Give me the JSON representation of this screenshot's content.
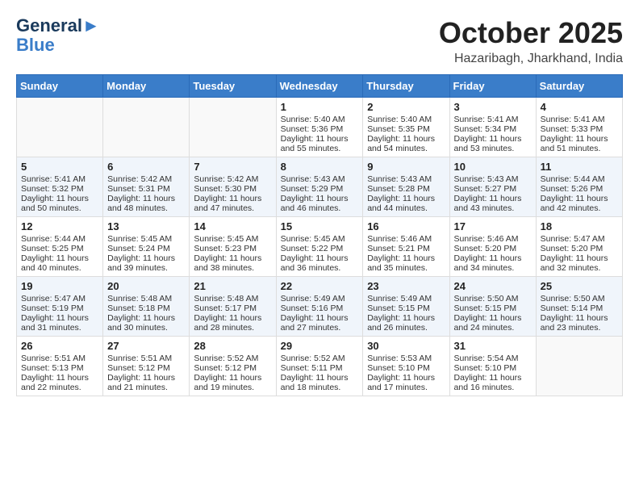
{
  "header": {
    "logo_line1": "General",
    "logo_line2": "Blue",
    "month": "October 2025",
    "location": "Hazaribagh, Jharkhand, India"
  },
  "weekdays": [
    "Sunday",
    "Monday",
    "Tuesday",
    "Wednesday",
    "Thursday",
    "Friday",
    "Saturday"
  ],
  "weeks": [
    [
      {
        "day": "",
        "info": ""
      },
      {
        "day": "",
        "info": ""
      },
      {
        "day": "",
        "info": ""
      },
      {
        "day": "1",
        "info": "Sunrise: 5:40 AM\nSunset: 5:36 PM\nDaylight: 11 hours\nand 55 minutes."
      },
      {
        "day": "2",
        "info": "Sunrise: 5:40 AM\nSunset: 5:35 PM\nDaylight: 11 hours\nand 54 minutes."
      },
      {
        "day": "3",
        "info": "Sunrise: 5:41 AM\nSunset: 5:34 PM\nDaylight: 11 hours\nand 53 minutes."
      },
      {
        "day": "4",
        "info": "Sunrise: 5:41 AM\nSunset: 5:33 PM\nDaylight: 11 hours\nand 51 minutes."
      }
    ],
    [
      {
        "day": "5",
        "info": "Sunrise: 5:41 AM\nSunset: 5:32 PM\nDaylight: 11 hours\nand 50 minutes."
      },
      {
        "day": "6",
        "info": "Sunrise: 5:42 AM\nSunset: 5:31 PM\nDaylight: 11 hours\nand 48 minutes."
      },
      {
        "day": "7",
        "info": "Sunrise: 5:42 AM\nSunset: 5:30 PM\nDaylight: 11 hours\nand 47 minutes."
      },
      {
        "day": "8",
        "info": "Sunrise: 5:43 AM\nSunset: 5:29 PM\nDaylight: 11 hours\nand 46 minutes."
      },
      {
        "day": "9",
        "info": "Sunrise: 5:43 AM\nSunset: 5:28 PM\nDaylight: 11 hours\nand 44 minutes."
      },
      {
        "day": "10",
        "info": "Sunrise: 5:43 AM\nSunset: 5:27 PM\nDaylight: 11 hours\nand 43 minutes."
      },
      {
        "day": "11",
        "info": "Sunrise: 5:44 AM\nSunset: 5:26 PM\nDaylight: 11 hours\nand 42 minutes."
      }
    ],
    [
      {
        "day": "12",
        "info": "Sunrise: 5:44 AM\nSunset: 5:25 PM\nDaylight: 11 hours\nand 40 minutes."
      },
      {
        "day": "13",
        "info": "Sunrise: 5:45 AM\nSunset: 5:24 PM\nDaylight: 11 hours\nand 39 minutes."
      },
      {
        "day": "14",
        "info": "Sunrise: 5:45 AM\nSunset: 5:23 PM\nDaylight: 11 hours\nand 38 minutes."
      },
      {
        "day": "15",
        "info": "Sunrise: 5:45 AM\nSunset: 5:22 PM\nDaylight: 11 hours\nand 36 minutes."
      },
      {
        "day": "16",
        "info": "Sunrise: 5:46 AM\nSunset: 5:21 PM\nDaylight: 11 hours\nand 35 minutes."
      },
      {
        "day": "17",
        "info": "Sunrise: 5:46 AM\nSunset: 5:20 PM\nDaylight: 11 hours\nand 34 minutes."
      },
      {
        "day": "18",
        "info": "Sunrise: 5:47 AM\nSunset: 5:20 PM\nDaylight: 11 hours\nand 32 minutes."
      }
    ],
    [
      {
        "day": "19",
        "info": "Sunrise: 5:47 AM\nSunset: 5:19 PM\nDaylight: 11 hours\nand 31 minutes."
      },
      {
        "day": "20",
        "info": "Sunrise: 5:48 AM\nSunset: 5:18 PM\nDaylight: 11 hours\nand 30 minutes."
      },
      {
        "day": "21",
        "info": "Sunrise: 5:48 AM\nSunset: 5:17 PM\nDaylight: 11 hours\nand 28 minutes."
      },
      {
        "day": "22",
        "info": "Sunrise: 5:49 AM\nSunset: 5:16 PM\nDaylight: 11 hours\nand 27 minutes."
      },
      {
        "day": "23",
        "info": "Sunrise: 5:49 AM\nSunset: 5:15 PM\nDaylight: 11 hours\nand 26 minutes."
      },
      {
        "day": "24",
        "info": "Sunrise: 5:50 AM\nSunset: 5:15 PM\nDaylight: 11 hours\nand 24 minutes."
      },
      {
        "day": "25",
        "info": "Sunrise: 5:50 AM\nSunset: 5:14 PM\nDaylight: 11 hours\nand 23 minutes."
      }
    ],
    [
      {
        "day": "26",
        "info": "Sunrise: 5:51 AM\nSunset: 5:13 PM\nDaylight: 11 hours\nand 22 minutes."
      },
      {
        "day": "27",
        "info": "Sunrise: 5:51 AM\nSunset: 5:12 PM\nDaylight: 11 hours\nand 21 minutes."
      },
      {
        "day": "28",
        "info": "Sunrise: 5:52 AM\nSunset: 5:12 PM\nDaylight: 11 hours\nand 19 minutes."
      },
      {
        "day": "29",
        "info": "Sunrise: 5:52 AM\nSunset: 5:11 PM\nDaylight: 11 hours\nand 18 minutes."
      },
      {
        "day": "30",
        "info": "Sunrise: 5:53 AM\nSunset: 5:10 PM\nDaylight: 11 hours\nand 17 minutes."
      },
      {
        "day": "31",
        "info": "Sunrise: 5:54 AM\nSunset: 5:10 PM\nDaylight: 11 hours\nand 16 minutes."
      },
      {
        "day": "",
        "info": ""
      }
    ]
  ]
}
